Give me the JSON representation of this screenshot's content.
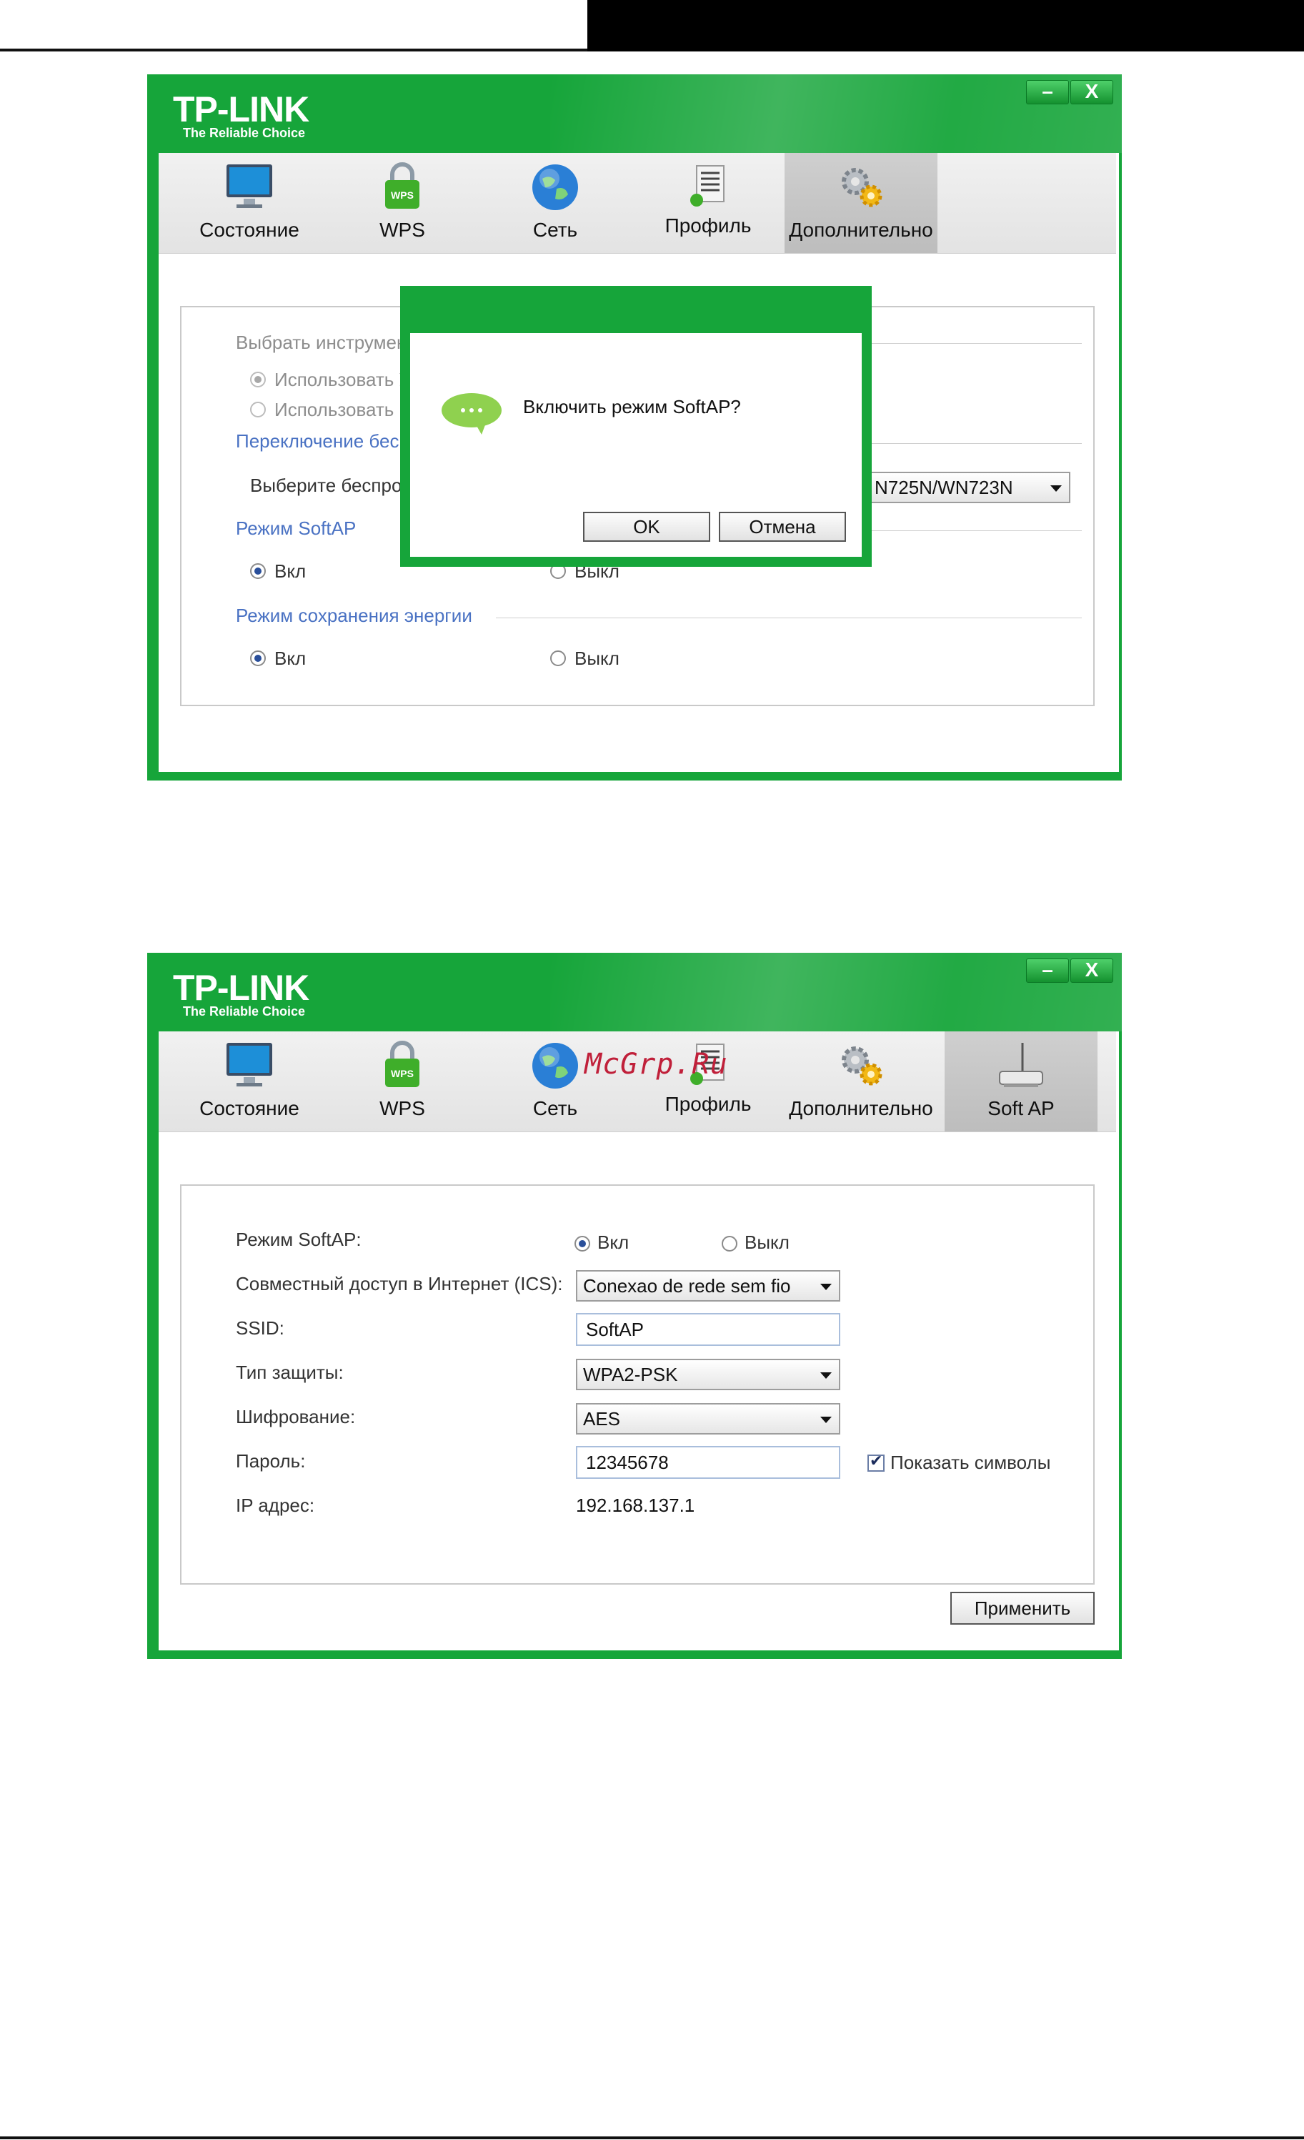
{
  "watermark": "McGrp.Ru",
  "brand": {
    "name": "TP-LINK",
    "tagline": "The Reliable Choice"
  },
  "window_buttons": {
    "minimize": "–",
    "close": "X"
  },
  "window1": {
    "tabs": [
      {
        "label": "Состояние",
        "icon": "monitor-icon"
      },
      {
        "label": "WPS",
        "icon": "wps-lock-icon"
      },
      {
        "label": "Сеть",
        "icon": "globe-icon"
      },
      {
        "label": "Профиль",
        "icon": "profile-document-icon"
      },
      {
        "label": "Дополнительно",
        "icon": "gears-icon",
        "active": true
      }
    ],
    "section_tool": "Выбрать инструмен",
    "opt_tool_1": "Использовать У",
    "opt_tool_2": "Использовать г",
    "section_switch": "Переключение бес",
    "select_wireless_label": "Выберите беспро",
    "select_wireless_value": "N725N/WN723N",
    "section_softap": "Режим SoftAP",
    "softap_on": "Вкл",
    "softap_off": "Выкл",
    "section_power": "Режим сохранения энергии",
    "power_on": "Вкл",
    "power_off": "Выкл",
    "dialog": {
      "message": "Включить режим SoftAP?",
      "ok": "OK",
      "cancel": "Отмена",
      "icon": "speech-bubble-icon"
    }
  },
  "window2": {
    "tabs": [
      {
        "label": "Состояние",
        "icon": "monitor-icon"
      },
      {
        "label": "WPS",
        "icon": "wps-lock-icon"
      },
      {
        "label": "Сеть",
        "icon": "globe-icon"
      },
      {
        "label": "Профиль",
        "icon": "profile-document-icon"
      },
      {
        "label": "Дополнительно",
        "icon": "gears-icon"
      },
      {
        "label": "Soft AP",
        "icon": "router-icon",
        "active": true
      }
    ],
    "softap_mode_label": "Режим SoftAP:",
    "softap_on": "Вкл",
    "softap_off": "Выкл",
    "ics_label": "Совместный доступ в Интернет (ICS):",
    "ics_value": "Conexao de rede sem fio",
    "ssid_label": "SSID:",
    "ssid_value": "SoftAP",
    "security_label": "Тип защиты:",
    "security_value": "WPA2-PSK",
    "encryption_label": "Шифрование:",
    "encryption_value": "AES",
    "password_label": "Пароль:",
    "password_value": "12345678",
    "show_chars_label": "Показать символы",
    "ip_label": "IP адрес:",
    "ip_value": "192.168.137.1",
    "apply": "Применить"
  }
}
